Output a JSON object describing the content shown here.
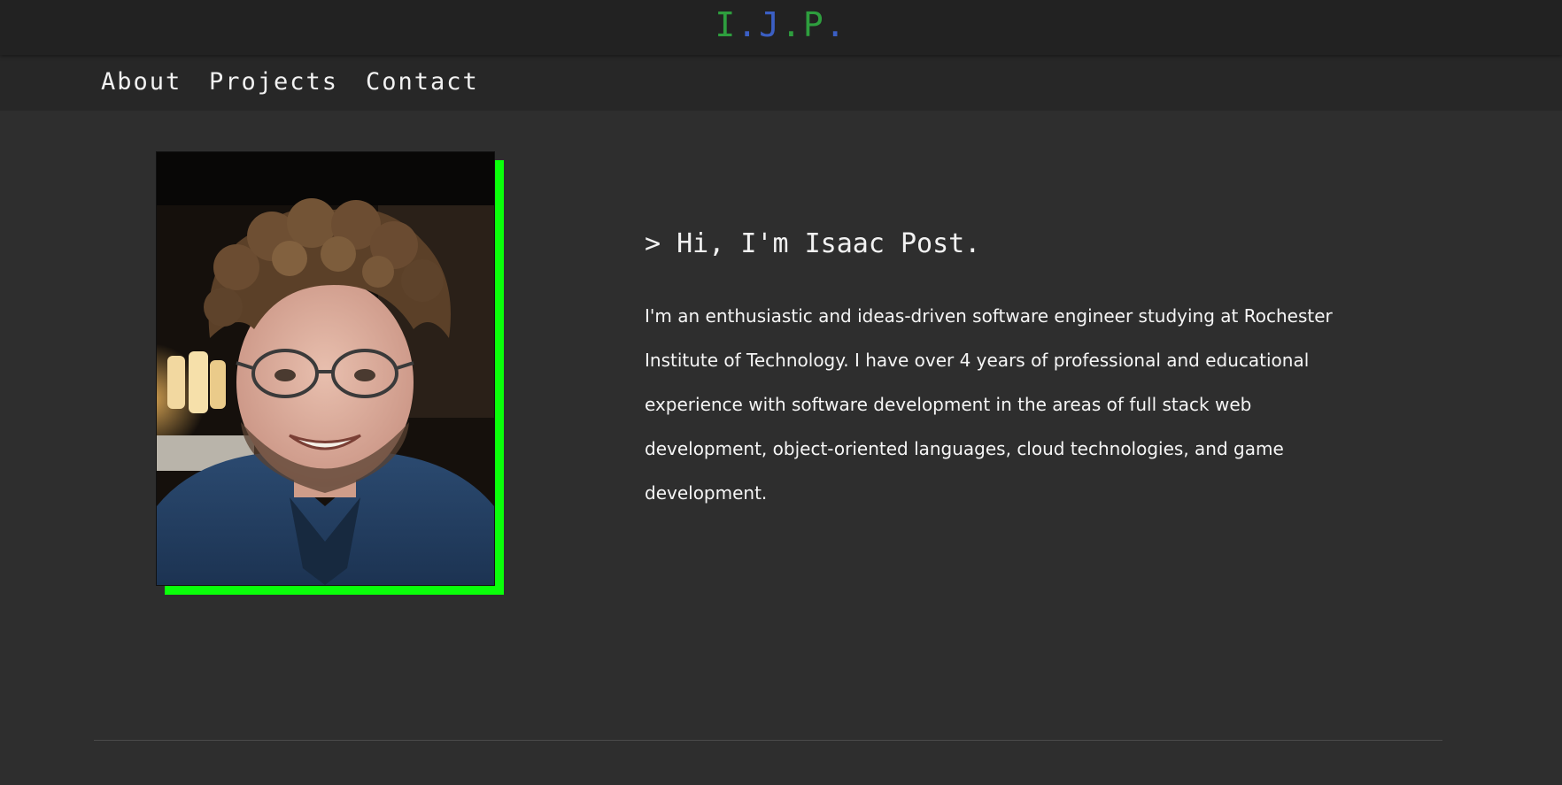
{
  "header": {
    "logo": [
      {
        "char": "I",
        "color": "#2e9e3e"
      },
      {
        "char": ".",
        "color": "#3b5fc4"
      },
      {
        "char": "J",
        "color": "#3b5fc4"
      },
      {
        "char": ".",
        "color": "#2e9e3e"
      },
      {
        "char": "P",
        "color": "#2e9e3e"
      },
      {
        "char": ".",
        "color": "#3b5fc4"
      }
    ]
  },
  "nav": {
    "items": [
      {
        "label": "About"
      },
      {
        "label": "Projects"
      },
      {
        "label": "Contact"
      }
    ]
  },
  "hero": {
    "photo_alt": "Portrait photo of Isaac Post",
    "accent_color": "#0aff0a",
    "greeting": "> Hi, I'm Isaac Post.",
    "bio_lines": [
      "I'm an enthusiastic and ideas-driven software engineer studying at Rochester",
      "Institute of Technology. I have over 4 years of professional and educational",
      "experience with software development in the areas of full stack web",
      "development, object-oriented languages, cloud technologies, and game",
      "development."
    ]
  }
}
